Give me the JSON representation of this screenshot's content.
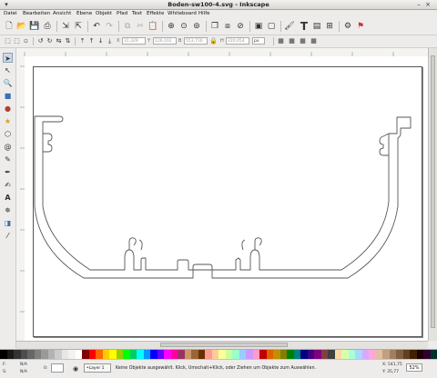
{
  "window": {
    "title": "Boden-sw100-4.svg - Inkscape"
  },
  "menu": [
    "Datei",
    "Bearbeiten",
    "Ansicht",
    "Ebene",
    "Objekt",
    "Pfad",
    "Text",
    "Effekte",
    "Whiteboard",
    "Hilfe"
  ],
  "toolbar_fields": {
    "x_value": "31,329",
    "y_value": "126,102",
    "w_value": "553,716",
    "h_value": "220,054",
    "units": "px"
  },
  "status": {
    "fill_label": "N/A",
    "stroke_label": "N/A",
    "opacity_value": "0:",
    "layer": "•Layer 1",
    "message": "Keine Objekte ausgewählt. Klick, Umschalt+Klick, oder Ziehen um Objekte zum Auswählen.",
    "x_coord": "X: 541,75",
    "y_coord": "Y: 35,77",
    "zoom": "52%"
  },
  "colors": {
    "accent": "#8aa0bb",
    "drawing_stroke": "#555555"
  },
  "palette": [
    "#000000",
    "#1a1a1a",
    "#333333",
    "#4d4d4d",
    "#666666",
    "#808080",
    "#999999",
    "#b3b3b3",
    "#cccccc",
    "#e6e6e6",
    "#f2f2f2",
    "#ffffff",
    "#800000",
    "#ff0000",
    "#ff6600",
    "#ffcc00",
    "#ffff00",
    "#99cc00",
    "#00ff00",
    "#00cc66",
    "#00ffff",
    "#0099ff",
    "#0000ff",
    "#6600ff",
    "#ff00ff",
    "#ff0099",
    "#993366",
    "#cc9966",
    "#996633",
    "#663300",
    "#ff9999",
    "#ffcc99",
    "#ffff99",
    "#ccff99",
    "#99ffcc",
    "#99ccff",
    "#cc99ff",
    "#ff99cc",
    "#c00000",
    "#e06000",
    "#c09000",
    "#808000",
    "#008000",
    "#008080",
    "#000080",
    "#400080",
    "#800080",
    "#804040",
    "#404040",
    "#ffd8a8",
    "#d8ffa8",
    "#a8ffd8",
    "#a8d8ff",
    "#d8a8ff",
    "#ffa8d8",
    "#e0c0a0",
    "#c0a080",
    "#a08060",
    "#806040",
    "#604020",
    "#402000",
    "#200000",
    "#300030",
    "#003030"
  ]
}
